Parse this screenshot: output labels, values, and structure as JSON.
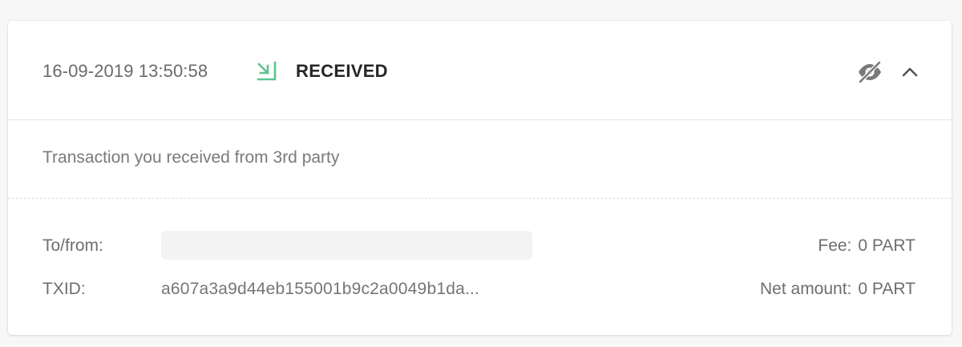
{
  "transaction": {
    "datetime": "16-09-2019 13:50:58",
    "direction_icon": "arrow-down-right-icon",
    "status": "RECEIVED",
    "status_color": "#5fc38f",
    "description": "Transaction you received from 3rd party",
    "to_from_label": "To/from:",
    "to_from_value": "",
    "txid_label": "TXID:",
    "txid_value": "a607a3a9d44eb155001b9c2a0049b1da...",
    "fee_label": "Fee:",
    "fee_value": "0 PART",
    "net_amount_label": "Net amount:",
    "net_amount_value": "0 PART"
  },
  "actions": {
    "hide_icon": "eye-slash-icon",
    "collapse_icon": "chevron-up-icon"
  }
}
